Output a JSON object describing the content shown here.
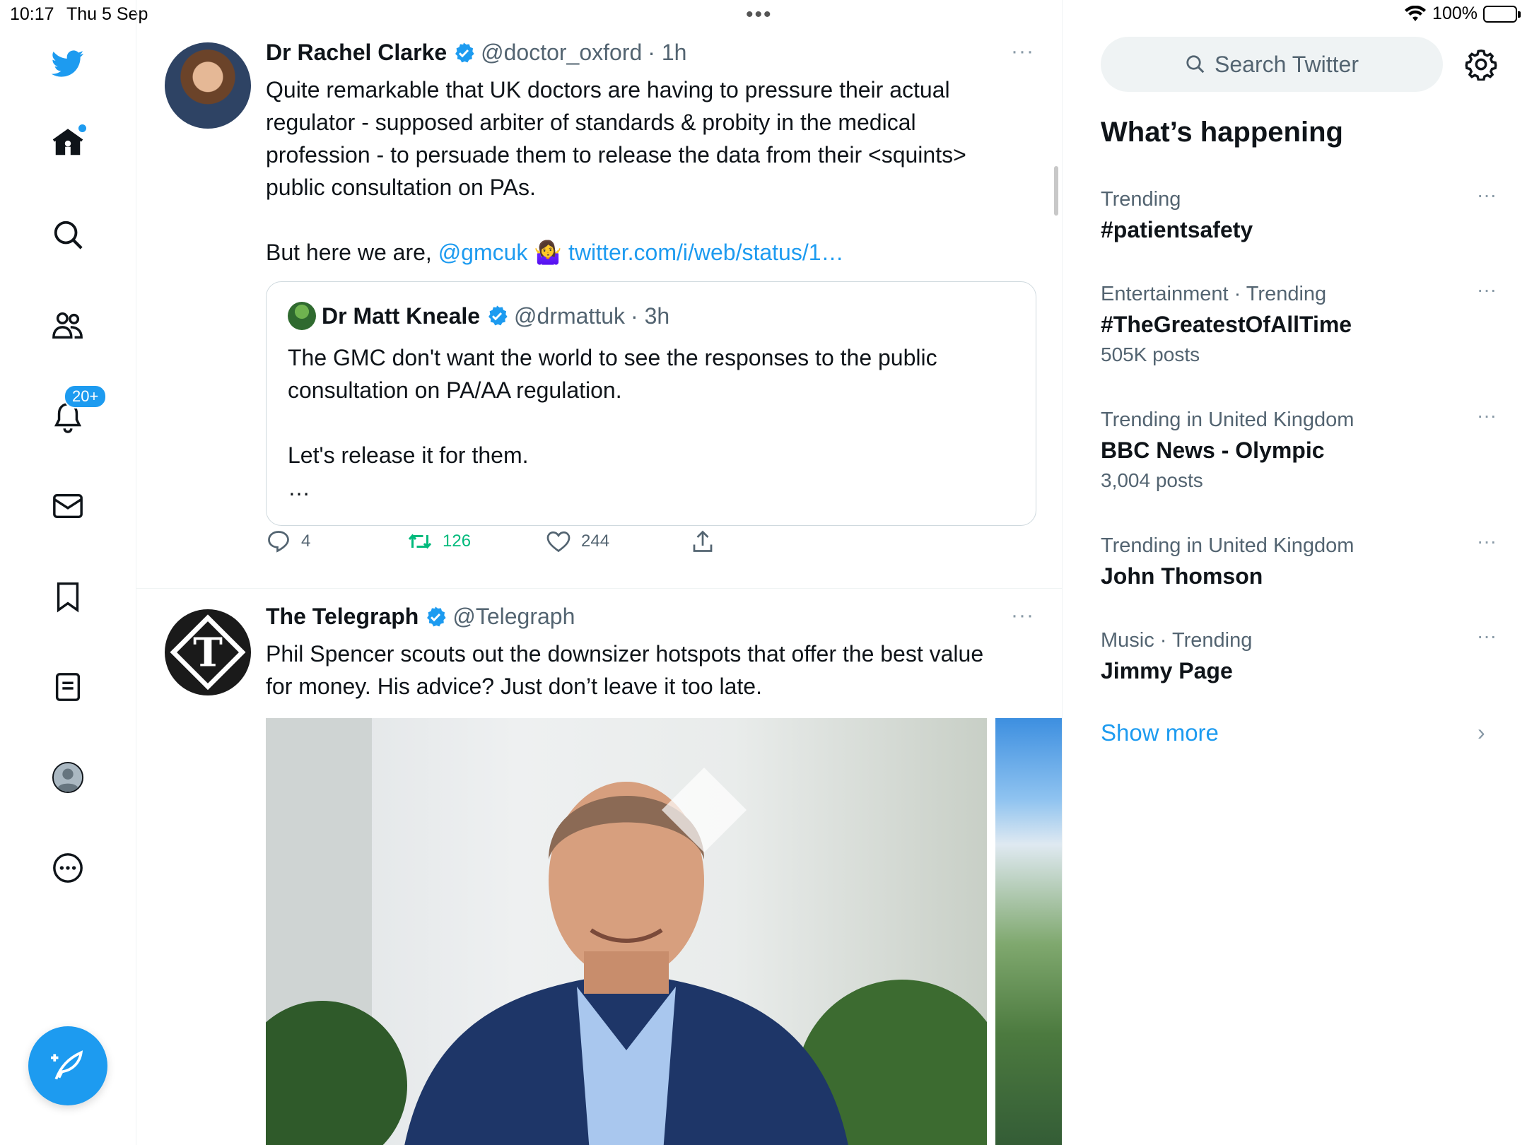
{
  "status_bar": {
    "time": "10:17",
    "date": "Thu 5 Sep",
    "battery": "100%",
    "multitask_dots": "•••"
  },
  "nav": {
    "items": [
      {
        "name": "logo",
        "icon": "twitter-bird-icon"
      },
      {
        "name": "home",
        "icon": "home-icon",
        "has_dot": true
      },
      {
        "name": "explore",
        "icon": "search-icon"
      },
      {
        "name": "communities",
        "icon": "people-icon"
      },
      {
        "name": "notifications",
        "icon": "bell-icon",
        "badge": "20+"
      },
      {
        "name": "messages",
        "icon": "envelope-icon"
      },
      {
        "name": "bookmarks",
        "icon": "bookmark-icon"
      },
      {
        "name": "lists",
        "icon": "list-icon"
      },
      {
        "name": "profile",
        "icon": "avatar-icon"
      },
      {
        "name": "more",
        "icon": "more-circle-icon"
      }
    ],
    "notifications_badge": "20+",
    "compose_icon": "compose-feather-icon"
  },
  "tweets": [
    {
      "name": "Dr Rachel Clarke",
      "handle": "@doctor_oxford",
      "time": "· 1h",
      "more": "···",
      "text": "Quite remarkable that UK doctors are having to pressure their actual regulator - supposed arbiter of standards & probity in the medical profession - to persuade them to release the data from their <squints> public consultation on PAs.\n\nBut here we are,",
      "mention": "@gmcuk",
      "emoji": "🤷‍♀️",
      "link": "twitter.com/i/web/status/1…",
      "quote": {
        "name": "Dr Matt Kneale",
        "handle": "@drmattuk",
        "time": "· 3h",
        "text": "The GMC don't want the world to see the responses to the public consultation on PA/AA regulation.\n\nLet's release it for them.\n…"
      },
      "replies": "4",
      "retweets": "126",
      "likes": "244"
    },
    {
      "name": "The Telegraph",
      "handle": "@Telegraph",
      "more": "···",
      "text": "Phil Spencer scouts out the downsizer hotspots that offer the best value for money. His advice? Just don’t leave it too late."
    }
  ],
  "sidebar": {
    "search_placeholder": "Search Twitter",
    "title": "What’s happening",
    "trends": [
      {
        "context": "Trending",
        "name": "#patientsafety",
        "posts": ""
      },
      {
        "context": "Entertainment · Trending",
        "name": "#TheGreatestOfAllTime",
        "posts": "505K posts"
      },
      {
        "context": "Trending in United Kingdom",
        "name": "BBC News - Olympic",
        "posts": "3,004 posts"
      },
      {
        "context": "Trending in United Kingdom",
        "name": "John Thomson",
        "posts": ""
      },
      {
        "context": "Music · Trending",
        "name": "Jimmy Page",
        "posts": ""
      }
    ],
    "trend_more": "···",
    "show_more": "Show more",
    "chevron": "›"
  },
  "colors": {
    "accent": "#1d9bf0",
    "retweet_green": "#00ba7c",
    "secondary_text": "#536471"
  }
}
